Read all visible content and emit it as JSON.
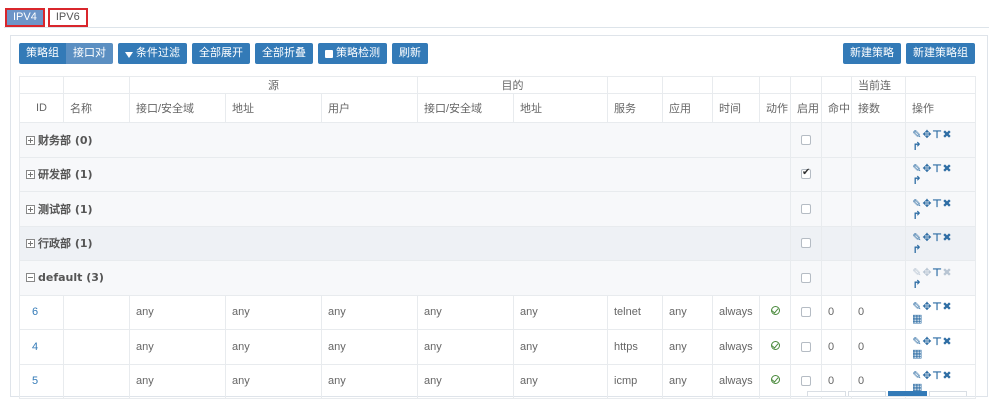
{
  "top_tabs": [
    "IPV4",
    "IPV6"
  ],
  "toolbar": {
    "policy_group": "策略组",
    "interface_pair": "接口对",
    "filter": "条件过滤",
    "expand_all": "全部展开",
    "collapse_all": "全部折叠",
    "policy_check": "策略检测",
    "refresh": "刷新",
    "new_policy": "新建策略",
    "new_policy_group": "新建策略组"
  },
  "table": {
    "group_headers": {
      "source": "源",
      "destination": "目的"
    },
    "columns": {
      "id": "ID",
      "name": "名称",
      "src_zone": "接口/安全域",
      "src_addr": "地址",
      "src_user": "用户",
      "dst_zone": "接口/安全域",
      "dst_addr": "地址",
      "service": "服务",
      "app": "应用",
      "time": "时间",
      "action": "动作",
      "enable": "启用",
      "hit": "命中",
      "current_conn_1": "当前连",
      "current_conn_2": "接数",
      "ops": "操作"
    },
    "groups": [
      {
        "label": "财务部 (0)",
        "enabled": false
      },
      {
        "label": "研发部 (1)",
        "enabled": true
      },
      {
        "label": "测试部 (1)",
        "enabled": false
      },
      {
        "label": "行政部 (1)",
        "enabled": false
      },
      {
        "label": "default (3)",
        "enabled": false
      }
    ],
    "rows": [
      {
        "id": "6",
        "name": "",
        "src_zone": "any",
        "src_addr": "any",
        "src_user": "any",
        "dst_zone": "any",
        "dst_addr": "any",
        "service": "telnet",
        "app": "any",
        "time": "always",
        "enabled": false,
        "hit": "0",
        "conn": "0"
      },
      {
        "id": "4",
        "name": "",
        "src_zone": "any",
        "src_addr": "any",
        "src_user": "any",
        "dst_zone": "any",
        "dst_addr": "any",
        "service": "https",
        "app": "any",
        "time": "always",
        "enabled": false,
        "hit": "0",
        "conn": "0"
      },
      {
        "id": "5",
        "name": "",
        "src_zone": "any",
        "src_addr": "any",
        "src_user": "any",
        "dst_zone": "any",
        "dst_addr": "any",
        "service": "icmp",
        "app": "any",
        "time": "always",
        "enabled": false,
        "hit": "0",
        "conn": "0"
      }
    ]
  },
  "icons": {
    "edit": "pencil-icon",
    "move": "move-icon",
    "pin": "pin-icon",
    "delete": "delete-icon",
    "forward": "forward-icon",
    "grid": "grid-icon",
    "action_allow": "check-circle-icon"
  },
  "colors": {
    "primary": "#337ab7",
    "tab_active": "#6d95c8",
    "tab_border": "#d9262c",
    "ok_green": "#4a8a3c"
  }
}
